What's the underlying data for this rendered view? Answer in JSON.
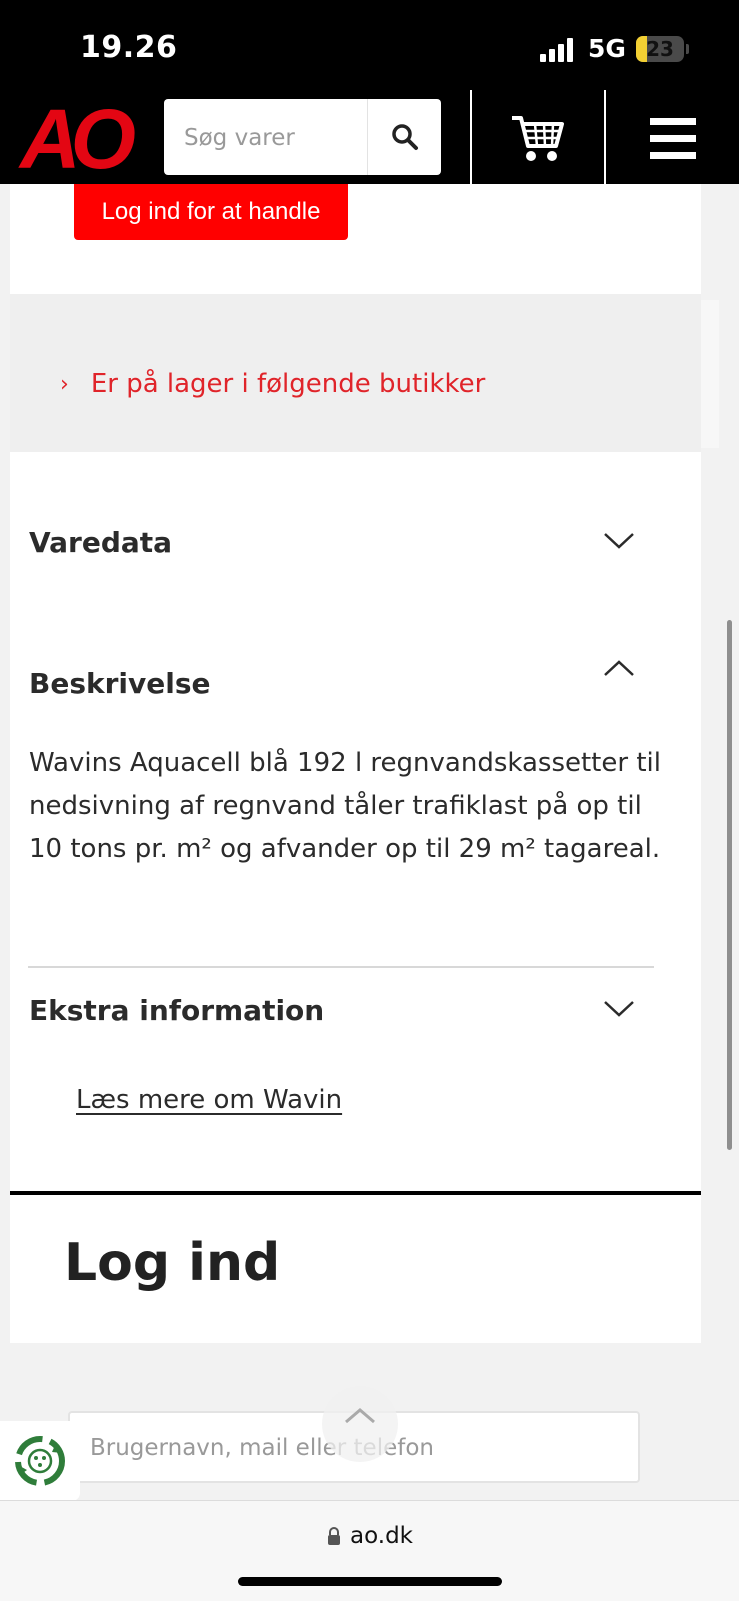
{
  "status_bar": {
    "time": "19.26",
    "network": "5G",
    "battery": "23",
    "battery_level": 0.23
  },
  "header": {
    "logo_text": "AO",
    "search_placeholder": "Søg varer",
    "icons": [
      "search-icon",
      "cart-icon",
      "menu-icon"
    ],
    "brand_color": "#e30613"
  },
  "product": {
    "login_button_label": "Log ind for at handle",
    "stock_link": "Er på lager i følgende butikker",
    "sections": [
      {
        "title": "Varedata",
        "expanded": false
      },
      {
        "title": "Beskrivelse",
        "expanded": true
      },
      {
        "title": "Ekstra information",
        "expanded": false
      }
    ],
    "description": "Wavins Aquacell blå 192 l regnvandskassetter til nedsivning af regnvand tåler trafiklast på op til 10 tons pr. m² og afvander op til 29 m² tagareal.",
    "extra_link": "Læs mere om Wavin"
  },
  "login": {
    "heading": "Log ind",
    "username_placeholder": "Brugernavn, mail eller telefon"
  },
  "browser": {
    "url": "ao.dk"
  },
  "colors": {
    "accent_red": "#ff0000",
    "link_red": "#e0242a",
    "eco_green": "#2f7d3a"
  }
}
